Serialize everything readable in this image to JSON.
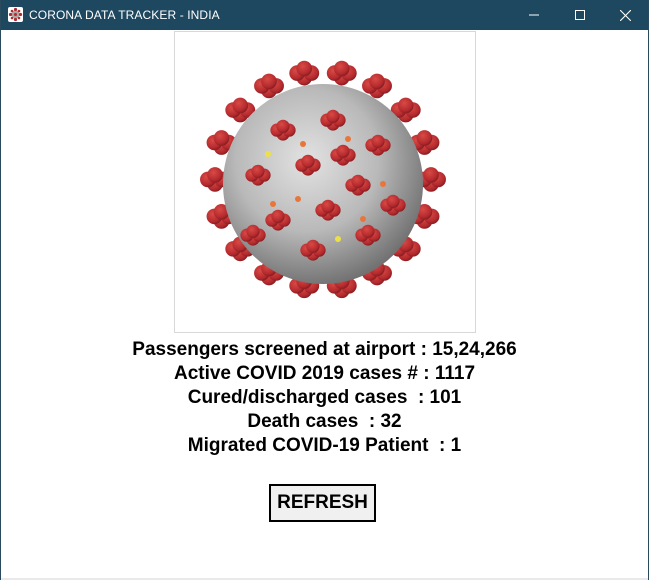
{
  "window": {
    "title": "CORONA DATA TRACKER - INDIA",
    "titlebar_color": "#1e4760"
  },
  "image": {
    "subject": "coronavirus-illustration",
    "colors": {
      "body": "#b9b9b9",
      "spike": "#b52a2e",
      "accent": "#e8763a",
      "highlight": "#ede046"
    }
  },
  "stats": {
    "passengers": "Passengers screened at airport : 15,24,266",
    "active": "Active COVID 2019 cases # : 1117",
    "cured": "Cured/discharged cases  : 101",
    "deaths": "Death cases  : 32",
    "migrated": "Migrated COVID-19 Patient  : 1"
  },
  "actions": {
    "refresh_label": "REFRESH"
  }
}
